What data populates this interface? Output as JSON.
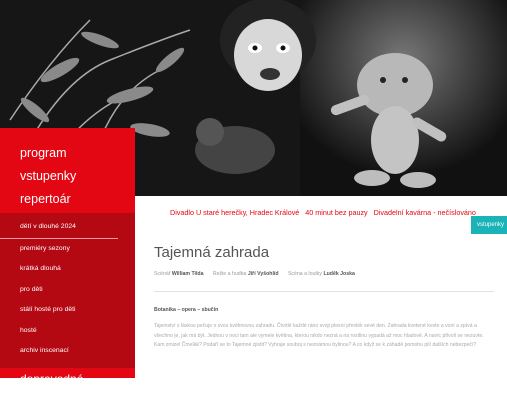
{
  "hero": {
    "alt": "puppeteer with troll puppet photo"
  },
  "nav": {
    "main": [
      "program",
      "vstupenky",
      "repertoár"
    ],
    "sub": [
      "dětí v dlouhé 2024",
      "premiéry sezony",
      "krátká dlouhá",
      "pro děti",
      "stálí hosté pro děti",
      "hosté",
      "archiv inscenací"
    ],
    "bottom": "doprovodné programy"
  },
  "info": {
    "venue": "Divadlo U staré herečky, Hradec Králové",
    "duration": "40 minut bez pauzy",
    "cafe": "Divadelní kavárna - nečíslováno"
  },
  "tag": "vstupenky",
  "show": {
    "title": "Tajemná zahrada",
    "credits": [
      {
        "role": "Scénář",
        "name": "William Tilda"
      },
      {
        "role": "Režie a hudba",
        "name": "Jiří Vyšohlíd"
      },
      {
        "role": "Scéna a loutky",
        "name": "Luděk Joska"
      }
    ],
    "genre": "Botanika – opera – sbučín",
    "text": "Tajemství s láskou pečuje o svou květinovou zahradu. Čtvrtlé každé ráno svoji plesní převlék sevě den. Zahrada kvetené kvete a voní a zpívá a všechno je, jak má být. Jednou v noci tam ale vymele květina, kterou nikdo nezná a na rostlinu vypadá až moc hladově. A navíc přivolí se nezuvte. Kam zmizel Čmelák? Podaří se to Tajemné zjistit? Vyhraje souboj s neznámou bylinou? A co když se k záhadě pomohu pilí dalších nebezpečí?"
  },
  "colors": {
    "brand_red": "#e30613",
    "dark_red": "#b40812",
    "accent_teal": "#1ab3b7"
  }
}
